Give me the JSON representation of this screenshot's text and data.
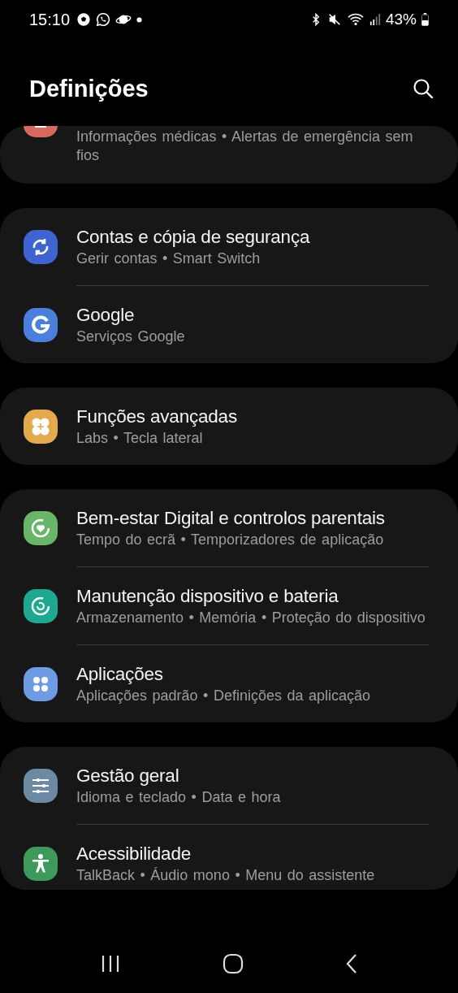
{
  "status_bar": {
    "time": "15:10",
    "battery_percent": "43%"
  },
  "header": {
    "title": "Definições"
  },
  "groups": [
    {
      "cut_top": true,
      "items": [
        {
          "subtitle": "Informações médicas • Alertas de emergência sem fios",
          "color": "#d9695f"
        }
      ]
    },
    {
      "items": [
        {
          "title": "Contas e cópia de segurança",
          "subtitle": "Gerir contas • Smart Switch",
          "color": "#3f63d0"
        },
        {
          "title": "Google",
          "subtitle": "Serviços Google",
          "color": "#4a7fdc"
        }
      ]
    },
    {
      "items": [
        {
          "title": "Funções avançadas",
          "subtitle": "Labs • Tecla lateral",
          "color": "#e3a94c"
        }
      ]
    },
    {
      "items": [
        {
          "title": "Bem-estar Digital e controlos parentais",
          "subtitle": "Tempo do ecrã • Temporizadores de aplicação",
          "color": "#69b56a"
        },
        {
          "title": "Manutenção dispositivo e bateria",
          "subtitle": "Armazenamento • Memória • Proteção do dispositivo",
          "color": "#1ea892"
        },
        {
          "title": "Aplicações",
          "subtitle": "Aplicações padrão • Definições da aplicação",
          "color": "#6e9be3"
        }
      ]
    },
    {
      "cut_bottom": true,
      "items": [
        {
          "title": "Gestão geral",
          "subtitle": "Idioma e teclado • Data e hora",
          "color": "#6c8aa3"
        },
        {
          "title": "Acessibilidade",
          "subtitle": "TalkBack • Áudio mono • Menu do assistente",
          "color": "#3e9a5a"
        }
      ]
    }
  ]
}
